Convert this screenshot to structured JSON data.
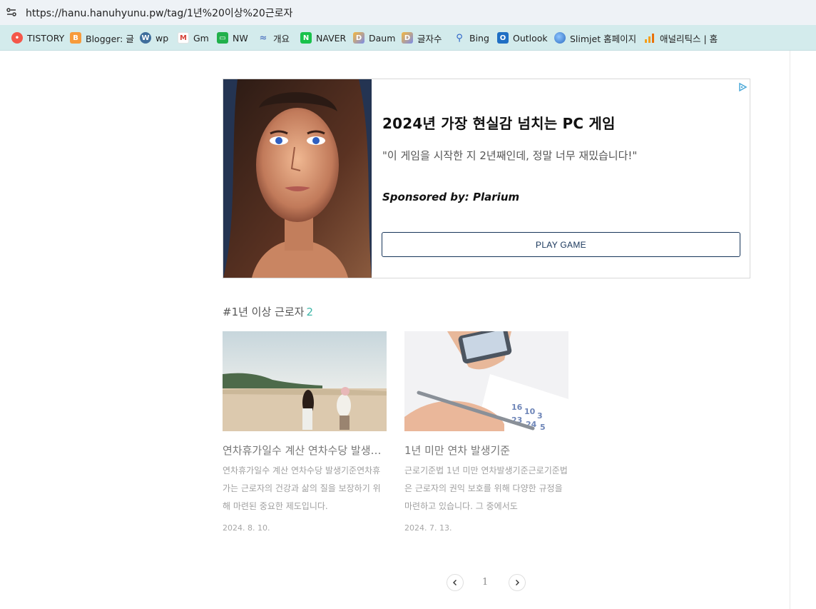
{
  "browser": {
    "url": "https://hanu.hanuhyunu.pw/tag/1년%20이상%20근로자"
  },
  "bookmarks": [
    {
      "label": "TISTORY",
      "icon": "tistory-icon",
      "color": "#f4574a",
      "glyph": "•"
    },
    {
      "label": "Blogger: 글",
      "icon": "blogger-icon",
      "color": "#f79b3b",
      "glyph": "B"
    },
    {
      "label": "wp",
      "icon": "wordpress-icon",
      "color": "#3f6e9c",
      "glyph": "W"
    },
    {
      "label": "Gm",
      "icon": "gmail-icon",
      "color": "#d6443a",
      "glyph": "M"
    },
    {
      "label": "NW",
      "icon": "monitor-icon",
      "color": "#21b04b",
      "glyph": "▭"
    },
    {
      "label": "개요",
      "icon": "search-console-icon",
      "color": "#5b7fc4",
      "glyph": "≈"
    },
    {
      "label": "NAVER",
      "icon": "naver-icon",
      "color": "#19c24b",
      "glyph": "N"
    },
    {
      "label": "Daum",
      "icon": "daum-icon",
      "color": "#7b8de8",
      "glyph": "D"
    },
    {
      "label": "글자수",
      "icon": "daum-icon",
      "color": "#7b8de8",
      "glyph": "D"
    },
    {
      "label": "Bing",
      "icon": "search-icon",
      "color": "#2b63c8",
      "glyph": "⚲"
    },
    {
      "label": "Outlook",
      "icon": "outlook-icon",
      "color": "#1f6fc4",
      "glyph": "O"
    },
    {
      "label": "Slimjet 홈페이지",
      "icon": "globe-icon",
      "color": "#3b7fd0",
      "glyph": "◉"
    },
    {
      "label": "애널리틱스 | 홈",
      "icon": "analytics-icon",
      "color": "#f4a01c",
      "glyph": "▮"
    }
  ],
  "ad": {
    "title": "2024년 가장 현실감 넘치는 PC 게임",
    "quote": "\"이 게임을 시작한 지 2년째인데, 정말 너무 재밌습니다!\"",
    "sponsor": "Sponsored by: Plarium",
    "cta": "PLAY GAME"
  },
  "tag": {
    "name": "#1년 이상 근로자",
    "count": "2"
  },
  "posts": [
    {
      "title": "연차휴가일수 계산 연차수당 발생기준",
      "summary": "연차휴가일수 계산 연차수당 발생기준연차휴가는 근로자의 건강과 삶의 질을 보장하기 위해 마련된 중요한 제도입니다.",
      "date": "2024. 8. 10."
    },
    {
      "title": "1년 미만 연차 발생기준",
      "summary": "근로기준법 1년 미만 연차발생기준근로기준법은 근로자의 권익 보호를 위해 다양한 규정을 마련하고 있습니다. 그 중에서도",
      "date": "2024. 7. 13."
    }
  ],
  "pagination": {
    "current": "1"
  },
  "colors": {
    "accent": "#3fb6a8",
    "cta_border": "#17355a",
    "bookmark_bar": "#d3ebec"
  }
}
